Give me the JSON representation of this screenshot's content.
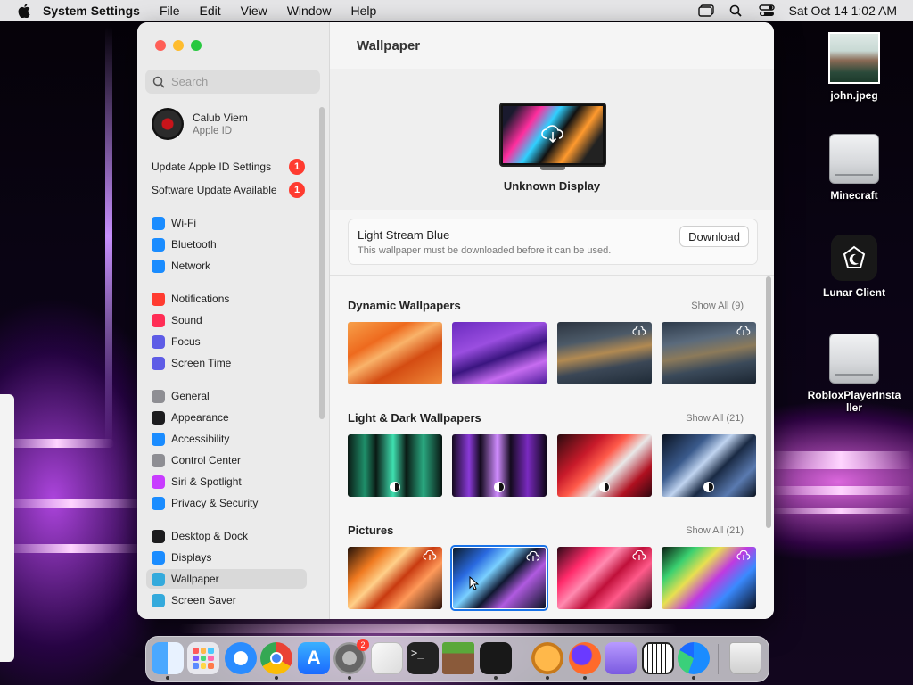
{
  "menubar": {
    "app_name": "System Settings",
    "menus": [
      "File",
      "Edit",
      "View",
      "Window",
      "Help"
    ],
    "clock": "Sat Oct 14  1:02 AM"
  },
  "desktop_icons": [
    {
      "label": "john.jpeg",
      "kind": "photo"
    },
    {
      "label": "Minecraft",
      "kind": "drive"
    },
    {
      "label": "Lunar Client",
      "kind": "app"
    },
    {
      "label": "RobloxPlayerInstaller",
      "kind": "drive"
    }
  ],
  "sidebar": {
    "search_placeholder": "Search",
    "profile": {
      "name": "Calub Viem",
      "subtitle": "Apple ID"
    },
    "notices": [
      {
        "label": "Update Apple ID Settings",
        "count": "1"
      },
      {
        "label": "Software Update Available",
        "count": "1"
      }
    ],
    "items": [
      {
        "label": "Wi-Fi",
        "icon": "wifi-icon",
        "color": "#1a8cff"
      },
      {
        "label": "Bluetooth",
        "icon": "bluetooth-icon",
        "color": "#1a8cff"
      },
      {
        "label": "Network",
        "icon": "network-icon",
        "color": "#1a8cff"
      },
      {
        "label": "Notifications",
        "icon": "notifications-icon",
        "color": "#ff3b30"
      },
      {
        "label": "Sound",
        "icon": "sound-icon",
        "color": "#ff2d55"
      },
      {
        "label": "Focus",
        "icon": "focus-icon",
        "color": "#5e5ce6"
      },
      {
        "label": "Screen Time",
        "icon": "screen-time-icon",
        "color": "#5e5ce6"
      },
      {
        "label": "General",
        "icon": "gear-icon",
        "color": "#8e8e93"
      },
      {
        "label": "Appearance",
        "icon": "appearance-icon",
        "color": "#1c1c1e"
      },
      {
        "label": "Accessibility",
        "icon": "accessibility-icon",
        "color": "#1a8cff"
      },
      {
        "label": "Control Center",
        "icon": "control-center-icon",
        "color": "#8e8e93"
      },
      {
        "label": "Siri & Spotlight",
        "icon": "siri-icon",
        "color": "#c83cff"
      },
      {
        "label": "Privacy & Security",
        "icon": "hand-icon",
        "color": "#1a8cff"
      },
      {
        "label": "Desktop & Dock",
        "icon": "dock-icon",
        "color": "#1c1c1e"
      },
      {
        "label": "Displays",
        "icon": "displays-icon",
        "color": "#1a8cff"
      },
      {
        "label": "Wallpaper",
        "icon": "wallpaper-icon",
        "color": "#34aadc",
        "selected": true
      },
      {
        "label": "Screen Saver",
        "icon": "screen-saver-icon",
        "color": "#34aadc"
      }
    ]
  },
  "content": {
    "title": "Wallpaper",
    "display_name": "Unknown Display",
    "download_card": {
      "title": "Light Stream Blue",
      "subtitle": "This wallpaper must be downloaded before it can be used.",
      "button": "Download"
    },
    "sections": [
      {
        "title": "Dynamic Wallpapers",
        "show_all": "Show All (9)"
      },
      {
        "title": "Light & Dark Wallpapers",
        "show_all": "Show All (21)"
      },
      {
        "title": "Pictures",
        "show_all": "Show All (21)"
      }
    ]
  },
  "dock": {
    "apps": [
      "Finder",
      "Launchpad",
      "Safari",
      "Chrome",
      "App Store",
      "System Settings",
      "TextEdit",
      "Terminal",
      "Minecraft",
      "Lunar Client",
      "Downloads",
      "Firefox",
      "Folder",
      "Piano",
      "Edge",
      "Trash"
    ],
    "settings_badge": "2"
  }
}
